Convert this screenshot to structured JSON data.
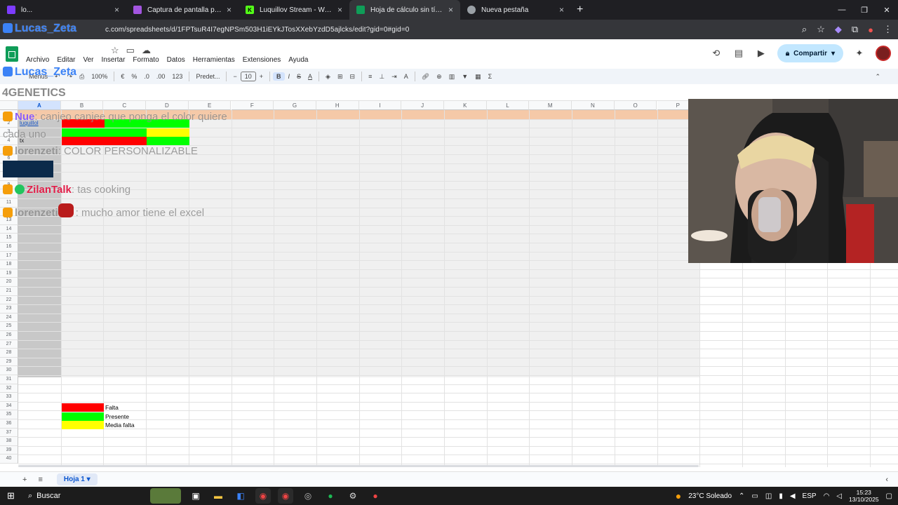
{
  "browser": {
    "tabs": [
      {
        "title": "lo...",
        "favicon_color": "#7d3cff",
        "active": false
      },
      {
        "title": "Captura de pantalla por Lightshot",
        "favicon_color": "#a355e0",
        "active": false
      },
      {
        "title": "Luquillov Stream - Watch Live o",
        "favicon_color": "#53fc18",
        "active": false
      },
      {
        "title": "Hoja de cálculo sin título - Hoja",
        "favicon_color": "#0f9d58",
        "active": true
      },
      {
        "title": "Nueva pestaña",
        "favicon_color": "#9aa0a6",
        "active": false
      }
    ],
    "new_tab": "+",
    "url": "c.com/spreadsheets/d/1FPTsuR4I7egNPSm503H1iEYkJTosXXebYzdD5ajlcks/edit?gid=0#gid=0"
  },
  "sheets": {
    "menus": [
      "Archivo",
      "Editar",
      "Ver",
      "Insertar",
      "Formato",
      "Datos",
      "Herramientas",
      "Extensiones",
      "Ayuda"
    ],
    "share_label": "Compartir",
    "toolbar": {
      "menus_label": "Menús",
      "zoom": "100%",
      "currency": "€",
      "percent": "%",
      "dec_less": ".0",
      "dec_more": ".00",
      "number_fmt": "123",
      "font": "Predet...",
      "font_size": "10",
      "bold": "B",
      "italic": "I",
      "strike": "S",
      "text_color": "A",
      "sigma": "Σ"
    },
    "columns": [
      "A",
      "B",
      "C",
      "D",
      "E",
      "F",
      "G",
      "H",
      "I",
      "J",
      "K",
      "L",
      "M",
      "N",
      "O",
      "P"
    ],
    "row_count": 40,
    "cells": {
      "a2": "luquillol",
      "a4": "tx"
    },
    "legend": [
      {
        "label": "Falta",
        "color": "#ff0000"
      },
      {
        "label": "Presente",
        "color": "#00ff00"
      },
      {
        "label": "Media falta",
        "color": "#ffff00"
      }
    ],
    "sheet_tab": "Hoja 1"
  },
  "overlay": {
    "chat": [
      {
        "user": "Lucas_Zeta",
        "text": "",
        "user_color": "#3b82f6"
      },
      {
        "user": "Lucas_Zeta",
        "text": "",
        "user_color": "#3b82f6"
      },
      {
        "user": "",
        "text": "4GENETICS",
        "user_color": "#555555"
      },
      {
        "user": "Nue",
        "text": ": canjeo canjee que ponga el color quiere cada uno",
        "user_color": "#8b5cf6"
      },
      {
        "user": "lorenzeti",
        "text": ": COLOR PERSONALIZABLE",
        "user_color": "#555555"
      },
      {
        "user": "ZilanTalk",
        "text": ": tas cooking",
        "user_color": "#e11d48"
      },
      {
        "user": "lorenzeti",
        "text": ": mucho amor tiene el excel",
        "user_color": "#555555"
      }
    ]
  },
  "taskbar": {
    "search": "Buscar",
    "weather": "23°C  Soleado",
    "lang": "ESP",
    "time": "15:23",
    "date": "13/10/2025"
  }
}
